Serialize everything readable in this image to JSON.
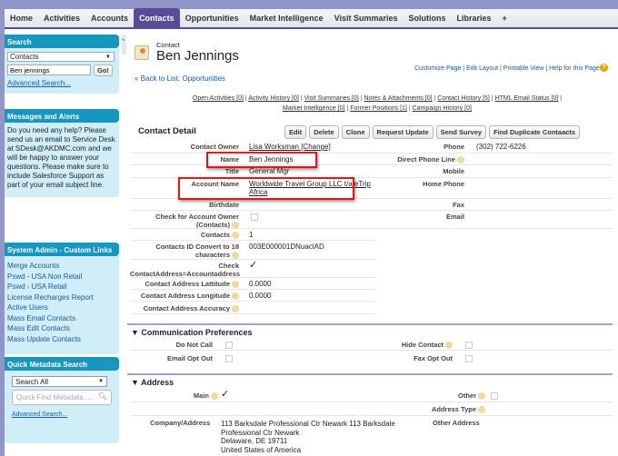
{
  "tabs": [
    "Home",
    "Activities",
    "Accounts",
    "Contacts",
    "Opportunities",
    "Market Intelligence",
    "Visit Summaries",
    "Solutions",
    "Libraries",
    "+"
  ],
  "sidebar": {
    "search": {
      "title": "Search",
      "scope": "Contacts",
      "query": "Ben jennings",
      "go": "Go!",
      "advanced": "Advanced Search..."
    },
    "messages": {
      "title": "Messages and Alerts",
      "text": "Do you need any help? Please send us an email to Service Desk at SDesk@AKDMC.com and we will be happy to answer your questions. Please make sure to include Salesforce Support as part of your email subject line."
    },
    "admin": {
      "title": "System Admin - Custom Links",
      "links": [
        "Merge Accounts",
        "Pswd - USA Non Retail",
        "Pswd - USA Retail",
        "License Recharges Report",
        "Active Users",
        "Mass Email Contacts",
        "Mass Edit Contacts",
        "Mass Update Contacts"
      ]
    },
    "meta": {
      "title": "Quick Metadata Search",
      "scope": "Search All",
      "placeholder": "Quick Find Metadata ...",
      "advanced": "Advanced Search..."
    }
  },
  "header": {
    "type": "Contact",
    "name": "Ben Jennings",
    "back": "« Back to List: Opportunities",
    "links": "Customize Page | Edit Layout | Printable View | Help for this Page"
  },
  "related": [
    "Open Activities [0]",
    "Activity History [0]",
    "Visit Summaries [0]",
    "Notes & Attachments [0]",
    "Contact History [5]",
    "HTML Email Status [0]",
    "Market Intelligence [0]",
    "Former Positions [1]",
    "Campaign History [0]"
  ],
  "detail": {
    "title": "Contact Detail",
    "buttons": [
      "Edit",
      "Delete",
      "Clone",
      "Request Update",
      "Send Survey",
      "Find Duplicate Contaacts"
    ],
    "left": [
      {
        "label": "Contact Owner",
        "value": "Lisa Worksman [Change]"
      },
      {
        "label": "Name",
        "value": "Ben Jennings"
      },
      {
        "label": "Title",
        "value": "General Mgr"
      },
      {
        "label": "Account Name",
        "value": "Worldwide Travel Group LLC t/a eTrip Africa"
      },
      {
        "label": "Birthdate",
        "value": ""
      },
      {
        "label": "Check for Account Owner (Contacts)",
        "value": ""
      },
      {
        "label": "Contacts",
        "value": "1"
      },
      {
        "label": "Contacts ID Convert to 18 characters",
        "value": "003E000001DNuaclAD"
      },
      {
        "label": "Check ContactAddress=Accountaddress",
        "value": "✓"
      },
      {
        "label": "Contact Address Lattitude",
        "value": "0.0000"
      },
      {
        "label": "Contact Address Longitude",
        "value": "0.0000"
      },
      {
        "label": "Contact Address Accuracy",
        "value": ""
      }
    ],
    "right": [
      {
        "label": "Phone",
        "value": "(302) 722-6226"
      },
      {
        "label": "Direct Phone Line",
        "value": ""
      },
      {
        "label": "Mobile",
        "value": ""
      },
      {
        "label": "Home Phone",
        "value": ""
      },
      {
        "label": "Fax",
        "value": ""
      },
      {
        "label": "Email",
        "value": ""
      }
    ]
  },
  "comm": {
    "title": "Communication Preferences",
    "do_not_call": "Do Not Call",
    "email_opt_out": "Email Opt Out",
    "hide_contact": "Hide Contact",
    "fax_opt_out": "Fax Opt Out"
  },
  "address": {
    "title": "Address",
    "main": "Main",
    "main_check": "✓",
    "other": "Other",
    "address_type": "Address Type",
    "company_label": "Company/Address",
    "company_lines": [
      "113 Barksdale Professional Ctr Newark 113 Barksdale",
      "Professional Ctr Newark",
      "Delaware, DE 19711",
      "United States of America"
    ],
    "other_address": "Other Address"
  }
}
